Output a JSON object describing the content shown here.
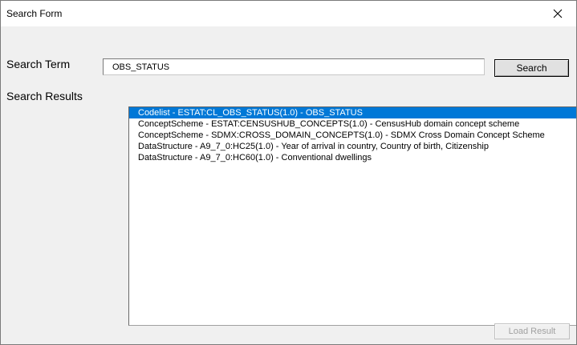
{
  "window": {
    "title": "Search Form"
  },
  "search": {
    "term_label": "Search Term",
    "value": "OBS_STATUS",
    "button_label": "Search"
  },
  "results": {
    "label": "Search Results",
    "items": [
      {
        "text": "Codelist - ESTAT:CL_OBS_STATUS(1.0) - OBS_STATUS",
        "selected": true
      },
      {
        "text": "ConceptScheme - ESTAT:CENSUSHUB_CONCEPTS(1.0) - CensusHub domain concept scheme",
        "selected": false
      },
      {
        "text": "ConceptScheme - SDMX:CROSS_DOMAIN_CONCEPTS(1.0) - SDMX Cross Domain Concept Scheme",
        "selected": false
      },
      {
        "text": "DataStructure - A9_7_0:HC25(1.0) - Year of arrival in country, Country of birth, Citizenship",
        "selected": false
      },
      {
        "text": "DataStructure - A9_7_0:HC60(1.0) - Conventional dwellings",
        "selected": false
      }
    ],
    "load_button_label": "Load Result",
    "load_button_enabled": false
  },
  "colors": {
    "selection": "#0078d7",
    "window_bg": "#f0f0f0"
  }
}
